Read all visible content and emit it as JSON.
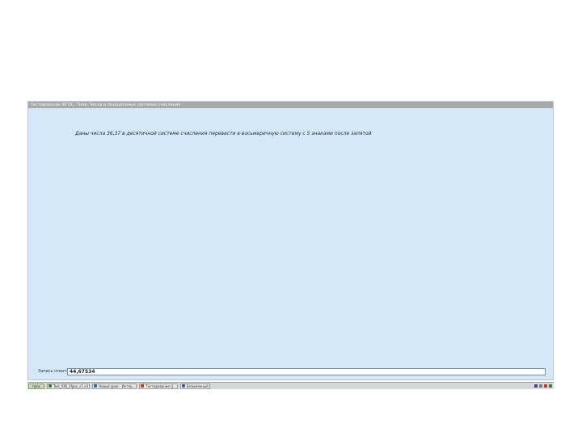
{
  "window": {
    "title": "Тестирование ФГОС: Тема: Числа в позиционных системах счисления",
    "task": "Даны числа 36,37 в десятичной системе счисления перевести в восьмеричную систему с 5 знаками после запятой"
  },
  "answer": {
    "label": "Запись ответа:",
    "value": "44,67534"
  },
  "taskbar": {
    "start_label": "пуск",
    "buttons": [
      {
        "label": "Test_IOB_1fgos_v1.x4",
        "icon_color": "#3a7a3a"
      },
      {
        "label": "Новый урок - Интер...",
        "icon_color": "#2a6aaa"
      },
      {
        "label": "Тестирование (J...",
        "icon_color": "#c04020"
      },
      {
        "label": "Безымянный",
        "icon_color": "#4060a0"
      }
    ],
    "tray_icons": [
      {
        "name": "keyboard-icon",
        "color": "#2a4a8a"
      },
      {
        "name": "speaker-icon",
        "color": "#7a7a7a"
      },
      {
        "name": "network-icon",
        "color": "#c03030"
      },
      {
        "name": "shield-icon",
        "color": "#3a7a3a"
      }
    ]
  }
}
